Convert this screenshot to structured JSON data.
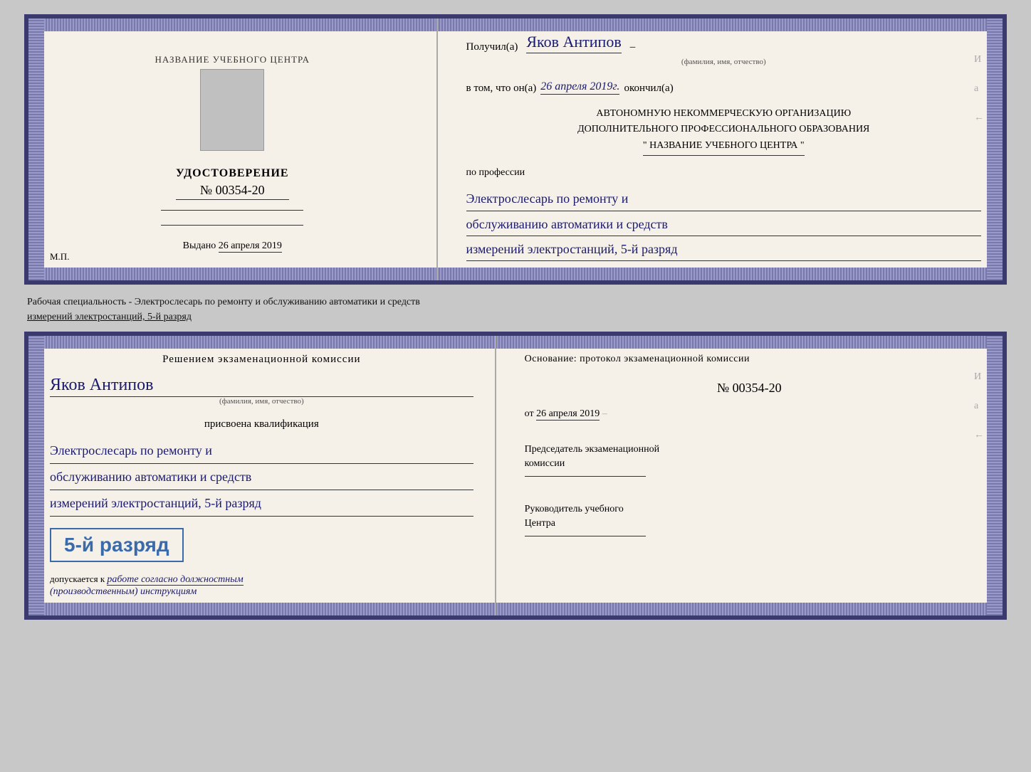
{
  "top_cert": {
    "left": {
      "org_name": "НАЗВАНИЕ УЧЕБНОГО ЦЕНТРА",
      "udostoverenie_label": "УДОСТОВЕРЕНИЕ",
      "cert_number": "№ 00354-20",
      "vydano_label": "Выдано",
      "vydano_date": "26 апреля 2019",
      "mp_label": "М.П."
    },
    "right": {
      "poluchil_prefix": "Получил(а)",
      "recipient_name": "Яков Антипов",
      "fio_subtitle": "(фамилия, имя, отчество)",
      "vtom_prefix": "в том, что он(а)",
      "completion_date": "26 апреля 2019г.",
      "okonchill": "окончил(а)",
      "org_line1": "АВТОНОМНУЮ НЕКОММЕРЧЕСКУЮ ОРГАНИЗАЦИЮ",
      "org_line2": "ДОПОЛНИТЕЛЬНОГО ПРОФЕССИОНАЛЬНОГО ОБРАЗОВАНИЯ",
      "org_line3": "\"   НАЗВАНИЕ УЧЕБНОГО ЦЕНТРА   \"",
      "po_professii": "по профессии",
      "profession_line1": "Электрослесарь по ремонту и",
      "profession_line2": "обслуживанию автоматики и средств",
      "profession_line3": "измерений электростанций, 5-й разряд",
      "side_marks": [
        "И",
        "а",
        "←"
      ]
    }
  },
  "middle_text": {
    "line1": "Рабочая специальность - Электрослесарь по ремонту и обслуживанию автоматики и средств",
    "line2": "измерений электростанций, 5-й разряд"
  },
  "bottom_cert": {
    "left": {
      "resheniem": "Решением экзаменационной комиссии",
      "fio_name": "Яков Антипов",
      "fio_subtitle": "(фамилия, имя, отчество)",
      "prisvoyena": "присвоена квалификация",
      "qual_line1": "Электрослесарь по ремонту и",
      "qual_line2": "обслуживанию автоматики и средств",
      "qual_line3": "измерений электростанций, 5-й разряд",
      "razryad_badge": "5-й разряд",
      "dopuskaetsya_prefix": "допускается к",
      "dopuskaetsya_handwritten": "работе согласно должностным",
      "dopuskaetsya_handwritten2": "(производственным) инструкциям"
    },
    "right": {
      "osnovanie": "Основание: протокол экзаменационной комиссии",
      "protocol_number": "№ 00354-20",
      "ot_prefix": "от",
      "ot_date": "26 апреля 2019",
      "predsedatel_line1": "Председатель экзаменационной",
      "predsedatel_line2": "комиссии",
      "rukovoditel_line1": "Руководитель учебного",
      "rukovoditel_line2": "Центра",
      "side_marks": [
        "И",
        "а",
        "←"
      ]
    }
  }
}
